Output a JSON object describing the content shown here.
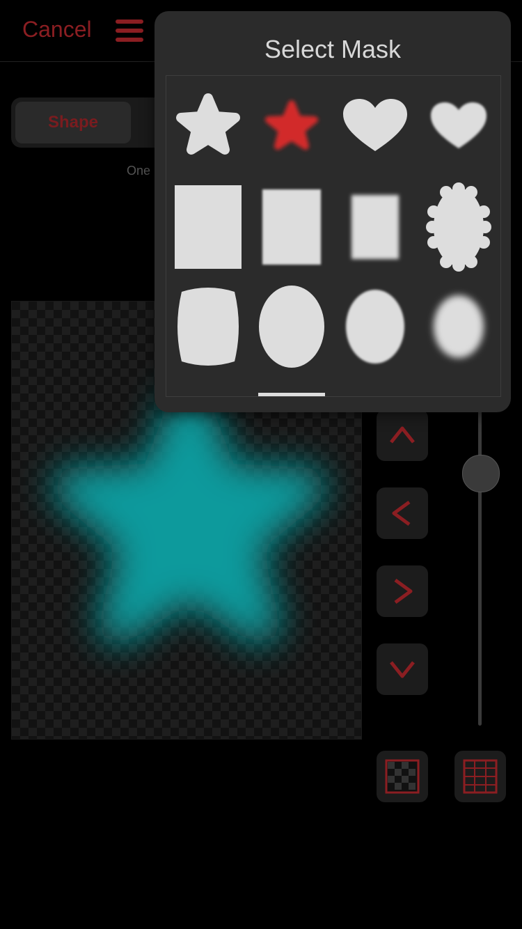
{
  "topbar": {
    "cancel_label": "Cancel"
  },
  "segmented": {
    "shape_label": "Shape"
  },
  "hint_text": "One",
  "popover": {
    "title": "Select Mask"
  },
  "colors": {
    "accent_red": "#8b1e22",
    "selected_red": "#d22a2a",
    "mask_fill": "#dddddd",
    "preview_teal": "#0a9a9c"
  },
  "masks": [
    {
      "icon": "rounded-star-icon",
      "selected": false
    },
    {
      "icon": "blurred-star-icon",
      "selected": true
    },
    {
      "icon": "heart-icon",
      "selected": false
    },
    {
      "icon": "soft-heart-icon",
      "selected": false
    },
    {
      "icon": "rectangle-icon",
      "selected": false
    },
    {
      "icon": "soft-rectangle-icon",
      "selected": false
    },
    {
      "icon": "blurred-rectangle-icon",
      "selected": false
    },
    {
      "icon": "scalloped-oval-icon",
      "selected": false
    },
    {
      "icon": "rounded-square-icon",
      "selected": false
    },
    {
      "icon": "oval-icon",
      "selected": false
    },
    {
      "icon": "soft-oval-icon",
      "selected": false
    },
    {
      "icon": "blurred-oval-icon",
      "selected": false
    }
  ],
  "controls": {
    "up_icon": "chevron-up-icon",
    "left_icon": "chevron-left-icon",
    "right_icon": "chevron-right-icon",
    "down_icon": "chevron-down-icon",
    "checker_icon": "checkerboard-icon",
    "grid_icon": "grid-icon"
  }
}
